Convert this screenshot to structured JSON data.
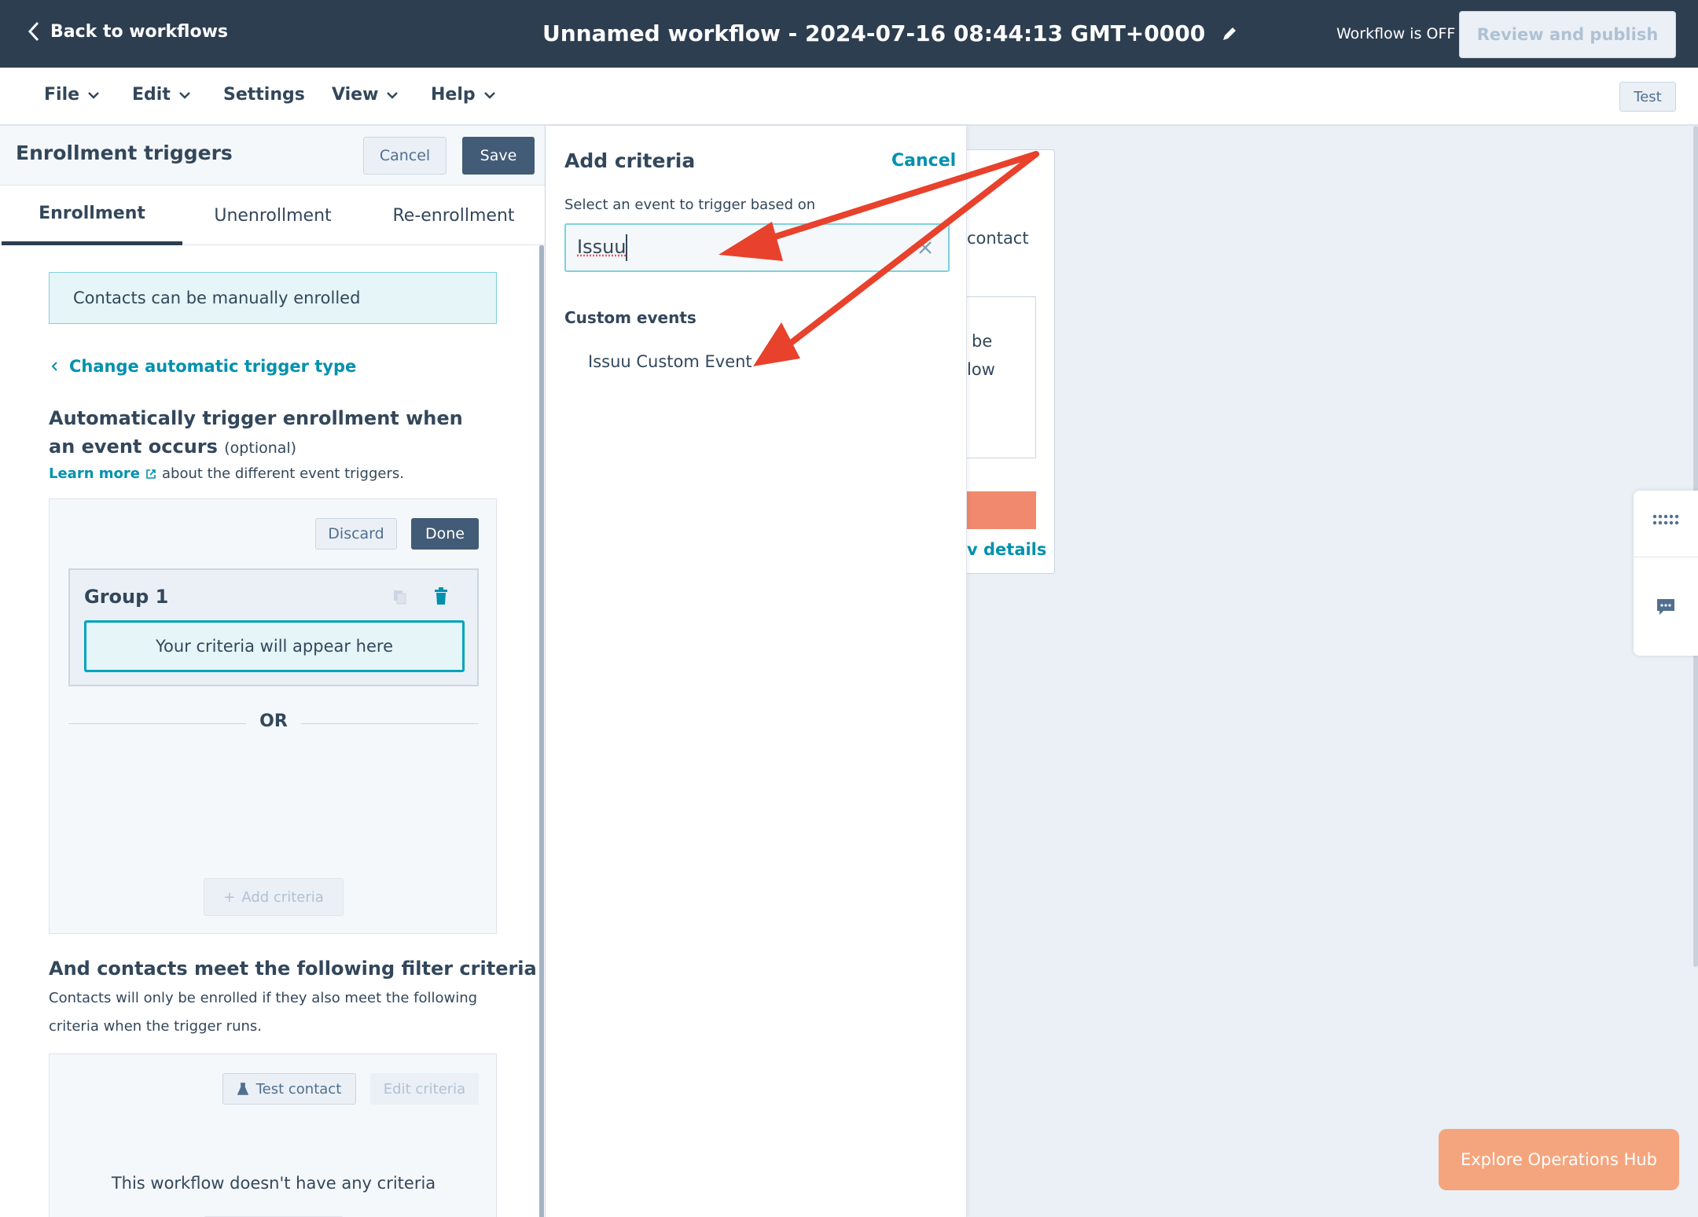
{
  "header": {
    "back_label": "Back to workflows",
    "workflow_title": "Unnamed workflow - 2024-07-16 08:44:13 GMT+0000",
    "status": "Workflow is OFF",
    "review_publish_label": "Review and publish"
  },
  "menu": {
    "items": [
      "File",
      "Edit",
      "Settings",
      "View",
      "Help"
    ],
    "test_label": "Test"
  },
  "enrollment_panel": {
    "title": "Enrollment triggers",
    "cancel_label": "Cancel",
    "save_label": "Save",
    "tabs": [
      "Enrollment",
      "Unenrollment",
      "Re-enrollment"
    ],
    "active_tab": "Enrollment",
    "manual_info": "Contacts can be manually enrolled",
    "change_trigger_link": "Change automatic trigger type",
    "auto_heading": "Automatically trigger enrollment when an event occurs",
    "optional": "(optional)",
    "learn_more": "Learn more",
    "learn_more_suffix": "about the different event triggers.",
    "discard_label": "Discard",
    "done_label": "Done",
    "group_title": "Group 1",
    "criteria_placeholder": "Your criteria will appear here",
    "or_label": "OR",
    "add_criteria_label": "Add criteria",
    "filter_heading": "And contacts meet the following filter criteria",
    "filter_description": "Contacts will only be enrolled if they also meet the following criteria when the trigger runs.",
    "test_contact_label": "Test contact",
    "edit_criteria_label": "Edit criteria",
    "no_criteria_text": "This workflow doesn't have any criteria"
  },
  "add_criteria_panel": {
    "title": "Add criteria",
    "cancel_label": "Cancel",
    "event_label": "Select an event to trigger based on",
    "search_value": "Issuu",
    "section_title": "Custom events",
    "options": [
      "Issuu Custom Event"
    ]
  },
  "canvas": {
    "card_text": "contact",
    "inner_text_1": "be",
    "inner_text_2": "low",
    "details_link": "v details"
  },
  "explore_button": "Explore Operations Hub",
  "colors": {
    "header_bg": "#2d3e50",
    "accent_teal": "#0091ae",
    "annotation_red": "#e8412c",
    "explore_orange": "#f5a57d"
  }
}
